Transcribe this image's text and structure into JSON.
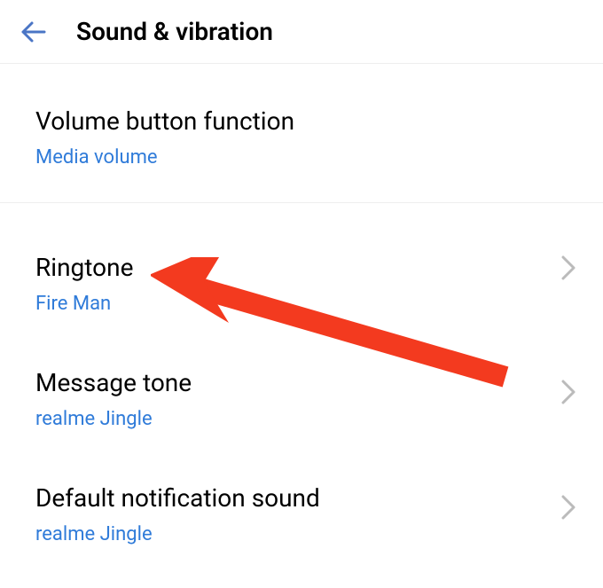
{
  "header": {
    "title": "Sound & vibration"
  },
  "items": [
    {
      "title": "Volume button function",
      "value": "Media volume",
      "hasChevron": false
    },
    {
      "title": "Ringtone",
      "value": "Fire Man",
      "hasChevron": true
    },
    {
      "title": "Message tone",
      "value": "realme Jingle",
      "hasChevron": true
    },
    {
      "title": "Default notification sound",
      "value": "realme Jingle",
      "hasChevron": true
    }
  ],
  "colors": {
    "accent": "#2f7bd9",
    "divider": "#eeeeee",
    "chevron": "#bbbbbb",
    "back": "#4a75c5",
    "annotation": "#f33a1f"
  }
}
